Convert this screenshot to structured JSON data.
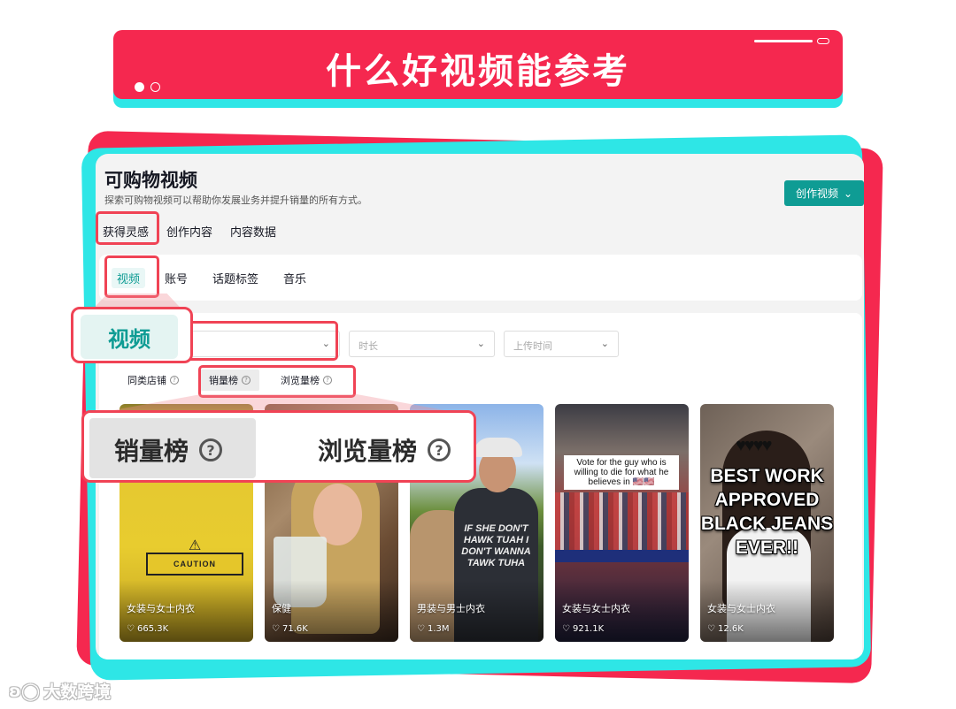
{
  "banner": {
    "title": "什么好视频能参考",
    "dots": 2,
    "active_dot": 1
  },
  "screen": {
    "title": "可购物视频",
    "subtitle": "探索可购物视频可以帮助你发展业务并提升销量的所有方式。",
    "create_button": "创作视频",
    "top_tabs": [
      {
        "label": "获得灵感",
        "selected": true
      },
      {
        "label": "创作内容"
      },
      {
        "label": "内容数据"
      }
    ],
    "sub_tabs": [
      {
        "label": "视频",
        "selected": true
      },
      {
        "label": "账号"
      },
      {
        "label": "话题标签"
      },
      {
        "label": "音乐"
      }
    ],
    "filters": {
      "select1_value": "",
      "duration_placeholder": "时长",
      "upload_time_placeholder": "上传时间"
    },
    "rank_tabs": [
      {
        "label": "同类店铺"
      },
      {
        "label": "销量榜",
        "selected": true
      },
      {
        "label": "浏览量榜"
      }
    ],
    "videos": [
      {
        "category": "女装与女士内衣",
        "likes": "665.3K",
        "overlay_text": "CAUTION"
      },
      {
        "category": "保健",
        "likes": "71.6K"
      },
      {
        "category": "男装与男士内衣",
        "likes": "1.3M",
        "overlay_text": "IF SHE DON'T HAWK TUAH I DON'T WANNA TAWK TUHA"
      },
      {
        "category": "女装与女士内衣",
        "likes": "921.1K",
        "overlay_text": "Vote for the guy who is willing to die for what he believes in 🇺🇸🇺🇸"
      },
      {
        "category": "女装与女士内衣",
        "likes": "12.6K",
        "overlay_text": "BEST WORK APPROVED BLACK JEANS EVER!!"
      }
    ]
  },
  "callouts": {
    "video_label": "视频",
    "rank_labels": [
      "销量榜",
      "浏览量榜"
    ]
  },
  "watermark": "大数跨境",
  "colors": {
    "accent_red": "#f5284f",
    "accent_cyan": "#2ee6e6",
    "brand_teal": "#0f9c94",
    "highlight": "#f04355"
  },
  "icons": [
    "chevron-down-icon",
    "question-circle-icon",
    "heart-icon"
  ]
}
